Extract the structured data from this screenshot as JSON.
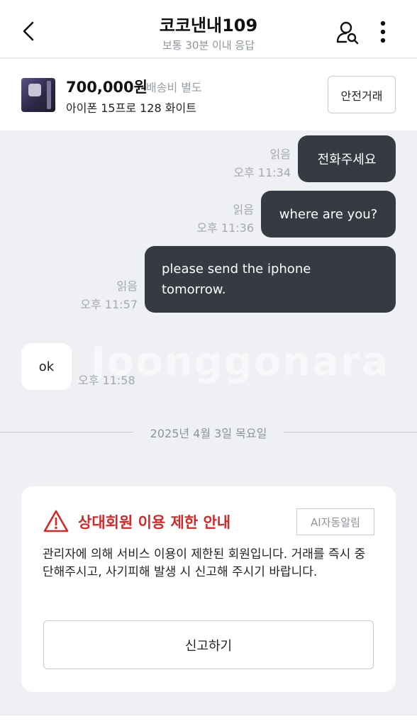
{
  "header": {
    "title": "코코낸내109",
    "subtitle": "보통 30분 이내 응답",
    "back_icon": "chevron-left-icon",
    "profile_icon": "user-search-icon",
    "more_icon": "more-vertical-icon"
  },
  "product": {
    "price": "700,000원",
    "shipping": "배송비 별도",
    "name": "아이폰 15프로 128 화이트",
    "safe_trade_label": "안전거래"
  },
  "messages": [
    {
      "direction": "out",
      "text": "전화주세요",
      "read": "읽음",
      "time": "오후 11:34"
    },
    {
      "direction": "out",
      "text": "where are you?",
      "read": "읽음",
      "time": "오후 11:36"
    },
    {
      "direction": "out",
      "text": "please send the iphone tomorrow.",
      "read": "읽음",
      "time": "오후 11:57"
    },
    {
      "direction": "in",
      "text": "ok",
      "time": "오후 11:58"
    }
  ],
  "watermark": "Joonggonara",
  "date_divider": "2025년 4월 3일 목요일",
  "notice": {
    "title": "상대회원 이용 제한 안내",
    "badge": "AI자동알림",
    "body": "관리자에 의해 서비스 이용이 제한된 회원입니다. 거래를 즉시 중단해주시고, 사기피해 발생 시 신고해 주시기 바랍니다.",
    "report_label": "신고하기",
    "accent_color": "#d42727"
  },
  "colors": {
    "outgoing_bubble": "#363a43",
    "background": "#eef0f3"
  }
}
